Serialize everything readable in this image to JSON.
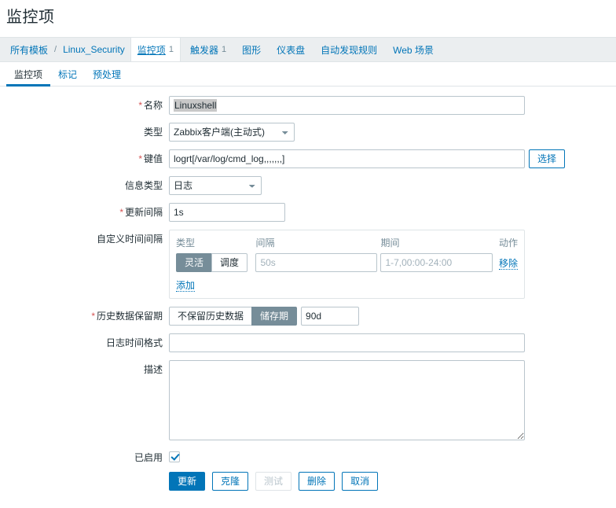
{
  "page": {
    "title": "监控项"
  },
  "breadcrumb": {
    "all_templates": "所有模板",
    "separator": "/",
    "template_name": "Linux_Security"
  },
  "nav": {
    "items": [
      {
        "label": "监控项",
        "count": "1",
        "active": true
      },
      {
        "label": "触发器",
        "count": "1",
        "active": false
      },
      {
        "label": "图形",
        "count": "",
        "active": false
      },
      {
        "label": "仪表盘",
        "count": "",
        "active": false
      },
      {
        "label": "自动发现规则",
        "count": "",
        "active": false
      },
      {
        "label": "Web 场景",
        "count": "",
        "active": false
      }
    ]
  },
  "tabs": [
    {
      "label": "监控项",
      "active": true
    },
    {
      "label": "标记",
      "active": false
    },
    {
      "label": "预处理",
      "active": false
    }
  ],
  "form": {
    "name": {
      "label": "名称",
      "required": true,
      "value": "Linuxshell",
      "selected": true
    },
    "type": {
      "label": "类型",
      "required": false,
      "value": "Zabbix客户端(主动式)",
      "options": [
        "Zabbix客户端(主动式)"
      ]
    },
    "key": {
      "label": "键值",
      "required": true,
      "value": "logrt[/var/log/cmd_log,,,,,,,]",
      "select_button": "选择"
    },
    "info_type": {
      "label": "信息类型",
      "required": false,
      "value": "日志",
      "options": [
        "日志"
      ]
    },
    "update_interval": {
      "label": "更新间隔",
      "required": true,
      "value": "1s"
    },
    "custom_intervals": {
      "label": "自定义时间间隔",
      "required": false,
      "headers": {
        "type": "类型",
        "interval": "间隔",
        "period": "期间",
        "action": "动作"
      },
      "rows": [
        {
          "type_flexible": "灵活",
          "type_scheduling": "调度",
          "type_selected": "灵活",
          "interval_value": "",
          "interval_placeholder": "50s",
          "period_value": "",
          "period_placeholder": "1-7,00:00-24:00",
          "remove_label": "移除"
        }
      ],
      "add_label": "添加"
    },
    "history": {
      "label": "历史数据保留期",
      "required": true,
      "option_none": "不保留历史数据",
      "option_storage": "储存期",
      "selected": "储存期",
      "value": "90d"
    },
    "log_time_format": {
      "label": "日志时间格式",
      "required": false,
      "value": ""
    },
    "description": {
      "label": "描述",
      "required": false,
      "value": ""
    },
    "enabled": {
      "label": "已启用",
      "required": false,
      "checked": true
    }
  },
  "buttons": {
    "update": "更新",
    "clone": "克隆",
    "test": "测试",
    "test_disabled": true,
    "delete": "删除",
    "cancel": "取消"
  },
  "colors": {
    "accent": "#0275b8",
    "required": "#d45353",
    "toggle_selected": "#768d99",
    "strip_bg": "#ebeef0",
    "border": "#dfe4e7",
    "input_border": "#b9c5cc",
    "muted_text": "#768d99"
  }
}
